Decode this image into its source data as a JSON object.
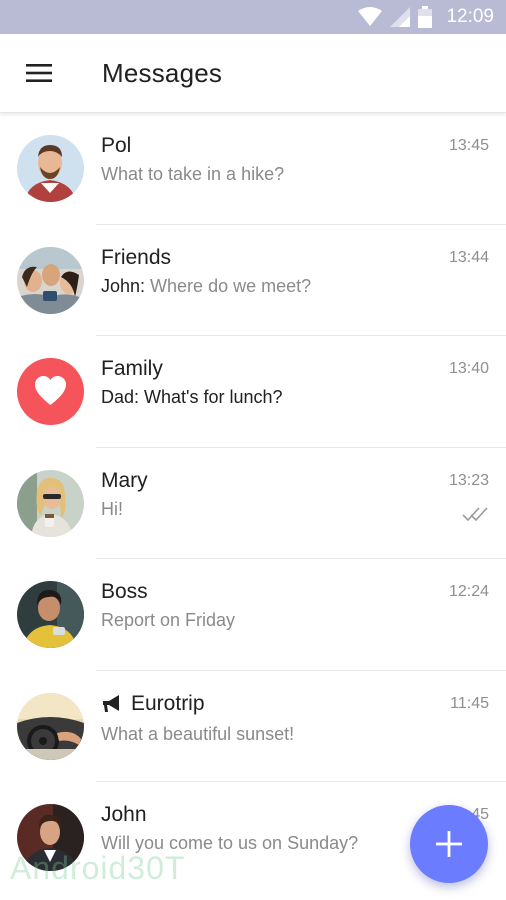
{
  "status_bar": {
    "time": "12:09",
    "icons": [
      "wifi-icon",
      "cell-signal-icon",
      "battery-icon"
    ]
  },
  "app_bar": {
    "title": "Messages",
    "menu_icon": "hamburger-menu-icon"
  },
  "chats": [
    {
      "name": "Pol",
      "sender": "",
      "message": "What to take in a hike?",
      "time": "13:45",
      "avatar": "photo-man-beard"
    },
    {
      "name": "Friends",
      "sender": "John: ",
      "message": "Where do we meet?",
      "time": "13:44",
      "avatar": "photo-group-selfie"
    },
    {
      "name": "Family",
      "sender": "Dad: ",
      "message": "What's for lunch?",
      "time": "13:40",
      "avatar": "heart-icon"
    },
    {
      "name": "Mary",
      "sender": "",
      "message": "Hi!",
      "time": "13:23",
      "avatar": "photo-woman-sunglasses",
      "status": "read-double-check-icon"
    },
    {
      "name": "Boss",
      "sender": "",
      "message": "Report on Friday",
      "time": "12:24",
      "avatar": "photo-man-phone"
    },
    {
      "name": "Eurotrip",
      "sender": "",
      "message": "What a beautiful sunset!",
      "time": "11:45",
      "avatar": "photo-car-sunset",
      "channel_icon": "megaphone-icon"
    },
    {
      "name": "John",
      "sender": "",
      "message": "Will you come to us on Sunday?",
      "time": "11:45",
      "avatar": "photo-man-suit"
    }
  ],
  "fab": {
    "icon": "plus-icon"
  },
  "watermark": "Android30T",
  "colors": {
    "status_bar": "#b9bad3",
    "accent": "#6b7cff",
    "heart_avatar": "#f5555a",
    "secondary_text": "#8a8a8a"
  }
}
